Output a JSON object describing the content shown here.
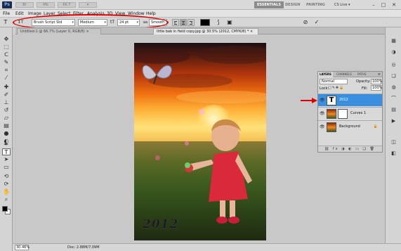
{
  "app": {
    "logo": "Ps",
    "mini_controls": [
      "Br",
      "Mb",
      "66.7",
      "▾"
    ],
    "workspaces": [
      {
        "label": "ESSENTIALS",
        "active": true
      },
      {
        "label": "DESIGN",
        "active": false
      },
      {
        "label": "PAINTING",
        "active": false
      }
    ],
    "cs_live": "CS Live ▾",
    "window_buttons": [
      "–",
      "□",
      "✕"
    ]
  },
  "menu": {
    "items": [
      "File",
      "Edit",
      "Image",
      "Layer",
      "Select",
      "Filter",
      "Analysis",
      "3D",
      "View",
      "Window",
      "Help"
    ]
  },
  "options": {
    "tool_glyph": "T",
    "font_family": "Brush Script Std",
    "font_style": "Medium",
    "font_size": "24 pt",
    "antialias_prefix": "aa",
    "antialias": "Smooth",
    "text_color": "#000000"
  },
  "tabs": [
    {
      "label": "Untitled-1 @ 66.7% (Layer 0, RGB/8) ×",
      "active": false
    },
    {
      "label": "little bab in field copy.jpg @ 30.5% (2012, CMYK/8) * ×",
      "active": true
    }
  ],
  "layers_panel": {
    "tabs": [
      "LAYERS",
      "CHANNELS",
      "PATHS"
    ],
    "blend_mode": "Normal",
    "opacity_label": "Opacity:",
    "opacity": "100%",
    "lock_label": "Lock:",
    "fill_label": "Fill:",
    "fill": "100%",
    "layers": [
      {
        "name": "2012",
        "type": "text",
        "selected": true,
        "visible": true
      },
      {
        "name": "Curves 1",
        "type": "adjustment",
        "selected": false,
        "visible": true
      },
      {
        "name": "Background",
        "type": "image",
        "selected": false,
        "visible": true,
        "locked": true
      }
    ]
  },
  "canvas": {
    "overlay_text": "2012"
  },
  "status": {
    "zoom": "30.46%",
    "doc": "Doc: 2.88M/7.09M"
  },
  "colors": {
    "annotation": "#e10000",
    "selection": "#3b8fe0"
  },
  "icons": {
    "tools": [
      "move",
      "marquee",
      "lasso",
      "quick-select",
      "crop",
      "eyedropper",
      "healing",
      "brush",
      "clone-stamp",
      "history-brush",
      "eraser",
      "gradient",
      "blur",
      "dodge",
      "pen",
      "type",
      "path-select",
      "shape",
      "3d-rotate",
      "3d-orbit",
      "hand",
      "zoom"
    ],
    "right_strip": [
      "minibridge",
      "adjustments",
      "masks",
      "layers",
      "channels",
      "paths",
      "history",
      "actions",
      "navigator",
      "color"
    ]
  }
}
